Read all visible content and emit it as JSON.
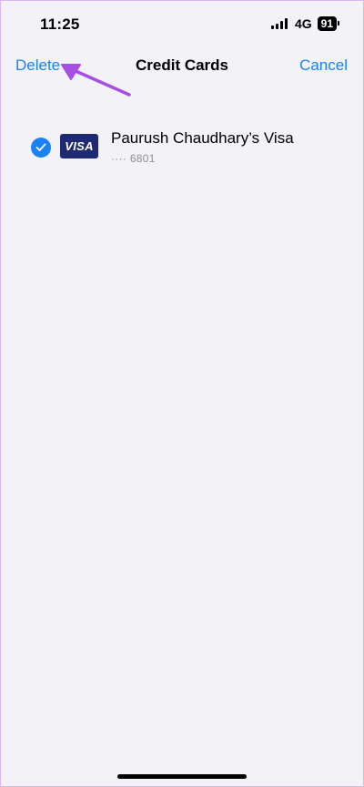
{
  "status_bar": {
    "time": "11:25",
    "network": "4G",
    "battery": "91"
  },
  "nav": {
    "left_label": "Delete",
    "title": "Credit Cards",
    "right_label": "Cancel"
  },
  "cards": [
    {
      "name": "Paurush Chaudhary’s Visa",
      "number": "···· 6801",
      "brand": "VISA",
      "selected": true
    }
  ],
  "colors": {
    "accent": "#1a82f5",
    "background": "#f2f2f7",
    "visa_blue": "#1f2a73",
    "annotation": "#a64ee6"
  },
  "icons": {
    "signal": "cellular-signal-icon",
    "check": "checkmark-icon",
    "arrow": "annotation-arrow-icon"
  }
}
